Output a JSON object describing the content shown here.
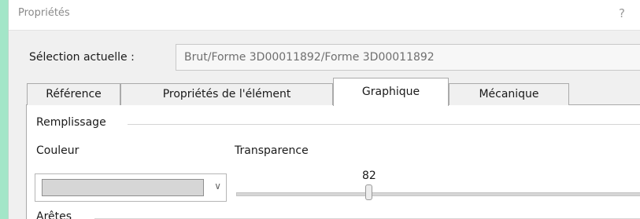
{
  "window": {
    "title": "Propriétés",
    "help_glyph": "?"
  },
  "selection": {
    "label": "Sélection actuelle :",
    "value": "Brut/Forme 3D00011892/Forme 3D00011892"
  },
  "tabs": [
    {
      "label": "Référence",
      "active": false
    },
    {
      "label": "Propriétés de l'élément",
      "active": false
    },
    {
      "label": "Graphique",
      "active": true
    },
    {
      "label": "Mécanique",
      "active": false
    }
  ],
  "fill_group": {
    "title": "Remplissage",
    "color_label": "Couleur",
    "color_value": "#d6d6d6",
    "transparency_label": "Transparence",
    "transparency_value": "82",
    "transparency_max": 100
  },
  "edges_group": {
    "title": "Arêtes"
  },
  "icons": {
    "help": "help-icon",
    "dropdown": "chevron-down-icon"
  },
  "colors": {
    "background": "#a3e6c8",
    "window_bg": "#f0f0f0",
    "panel_bg": "#ffffff"
  }
}
